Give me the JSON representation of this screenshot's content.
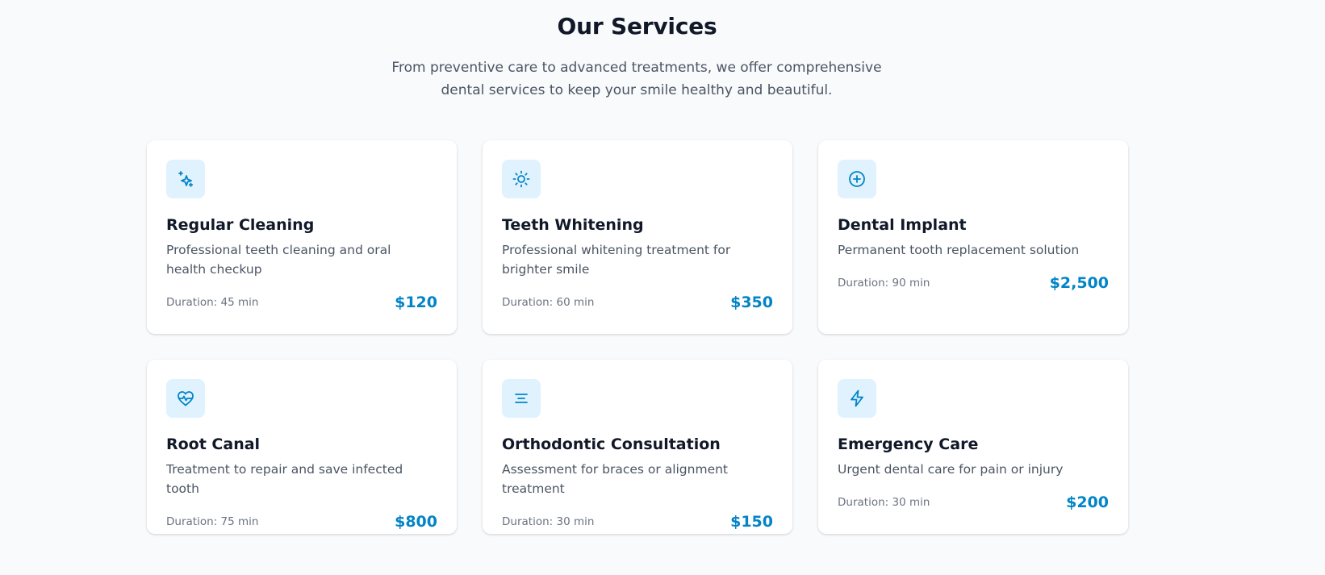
{
  "header": {
    "title": "Our Services",
    "subtitle": "From preventive care to advanced treatments, we offer comprehensive dental services to keep your smile healthy and beautiful."
  },
  "colors": {
    "accent": "#0284c7",
    "icon_bg": "#e0f2fe",
    "background": "#f8fafc"
  },
  "services": [
    {
      "icon": "sparkles-icon",
      "title": "Regular Cleaning",
      "description": "Professional teeth cleaning and oral health checkup",
      "duration": "Duration: 45 min",
      "price": "$120"
    },
    {
      "icon": "sun-icon",
      "title": "Teeth Whitening",
      "description": "Professional whitening treatment for brighter smile",
      "duration": "Duration: 60 min",
      "price": "$350"
    },
    {
      "icon": "plus-circle-icon",
      "title": "Dental Implant",
      "description": "Permanent tooth replacement solution",
      "duration": "Duration: 90 min",
      "price": "$2,500"
    },
    {
      "icon": "heart-pulse-icon",
      "title": "Root Canal",
      "description": "Treatment to repair and save infected tooth",
      "duration": "Duration: 75 min",
      "price": "$800"
    },
    {
      "icon": "align-center-icon",
      "title": "Orthodontic Consultation",
      "description": "Assessment for braces or alignment treatment",
      "duration": "Duration: 30 min",
      "price": "$150"
    },
    {
      "icon": "lightning-icon",
      "title": "Emergency Care",
      "description": "Urgent dental care for pain or injury",
      "duration": "Duration: 30 min",
      "price": "$200"
    }
  ]
}
